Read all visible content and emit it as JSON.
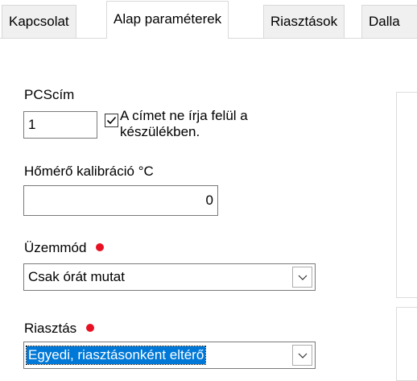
{
  "tabs": [
    {
      "label": "Kapcsolat",
      "active": false
    },
    {
      "label": "Alap paraméterek",
      "active": true
    },
    {
      "label": "Riasztások",
      "active": false
    },
    {
      "label": "Dalla",
      "active": false
    }
  ],
  "pcs_address": {
    "label": "PCScím",
    "value": "1",
    "checkbox_checked": true,
    "checkbox_label_line1": "A címet ne írja felül a",
    "checkbox_label_line2": "készülékben."
  },
  "thermometer_calibration": {
    "label": "Hőmérő kalibráció °C",
    "value": "0"
  },
  "operating_mode": {
    "label": "Üzemmód",
    "value": "Csak órát mutat",
    "required_color": "#e81123"
  },
  "alarm": {
    "label": "Riasztás",
    "value": "Egyedi, riasztásonként eltérő",
    "required_color": "#e81123"
  },
  "colors": {
    "selection": "#0078d7",
    "required_dot": "#e81123"
  }
}
